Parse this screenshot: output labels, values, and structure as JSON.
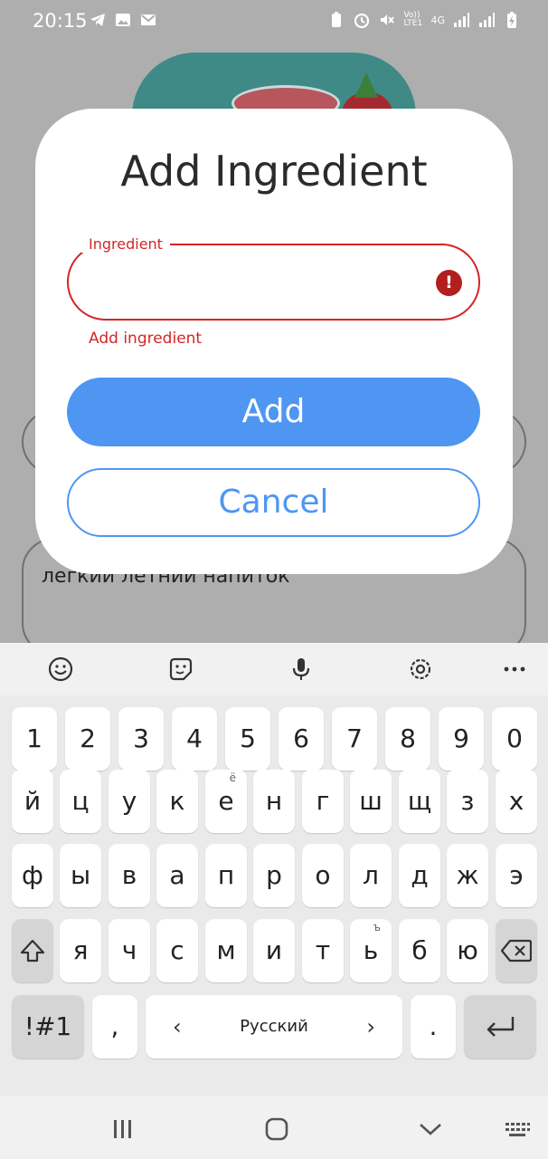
{
  "status_bar": {
    "time": "20:15",
    "left_icons": [
      "telegram-icon",
      "image-icon",
      "mail-icon"
    ],
    "right_icons": [
      "battery-saver-icon",
      "alarm-icon",
      "mute-icon",
      "volte-icon",
      "4g-icon",
      "signal-icon",
      "signal-icon",
      "battery-charging-icon"
    ],
    "volte_label": "Vo)) LTE1",
    "network_label": "4G"
  },
  "background": {
    "description_text": "легкий летний напиток"
  },
  "dialog": {
    "title": "Add Ingredient",
    "field_label": "Ingredient",
    "field_value": "",
    "field_error": "Add ingredient",
    "add_label": "Add",
    "cancel_label": "Cancel"
  },
  "keyboard": {
    "toolbar_icons": [
      "emoji-icon",
      "sticker-icon",
      "microphone-icon",
      "settings-icon",
      "more-icon"
    ],
    "row_numbers": [
      "1",
      "2",
      "3",
      "4",
      "5",
      "6",
      "7",
      "8",
      "9",
      "0"
    ],
    "row1": [
      "й",
      "ц",
      "у",
      "к",
      "е",
      "н",
      "г",
      "ш",
      "щ",
      "з",
      "х"
    ],
    "row1_sub_e": "ё",
    "row2": [
      "ф",
      "ы",
      "в",
      "а",
      "п",
      "р",
      "о",
      "л",
      "д",
      "ж",
      "э"
    ],
    "row3": [
      "я",
      "ч",
      "с",
      "м",
      "и",
      "т",
      "ь",
      "б",
      "ю"
    ],
    "row3_sub_soft": "ъ",
    "symbols_label": "!#1",
    "comma_label": ",",
    "space_label": "Русский",
    "period_label": "."
  },
  "colors": {
    "accent": "#4e96f2",
    "error": "#d32626",
    "scrim": "#aeaeae"
  }
}
